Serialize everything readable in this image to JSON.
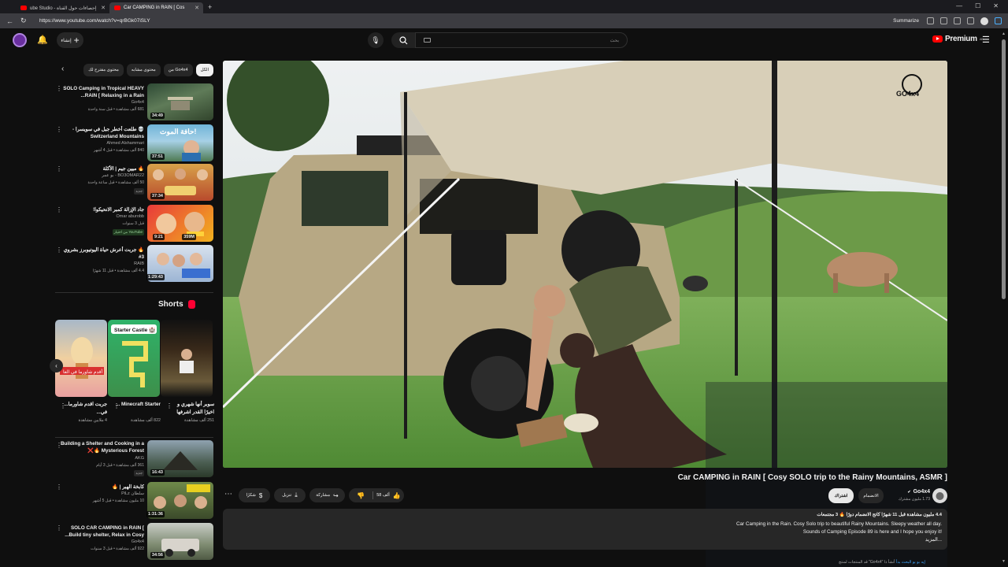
{
  "browser": {
    "tabs": [
      {
        "label": "ube Studio - إحصاءات حول القناة",
        "active": false
      },
      {
        "label": "Car CAMPING in RAIN [ Cos",
        "active": true
      }
    ],
    "url": "https://www.youtube.com/watch?v=qrBGk07iSLY",
    "summarize_label": "Summarize"
  },
  "header": {
    "create_label": "إنشاء",
    "search_placeholder": "بحث",
    "logo_text": "Premium",
    "logo_sup": "AE"
  },
  "chips": [
    "الكل",
    "من Go4x4",
    "محتوى مشابه",
    "محتوى مقترح لك"
  ],
  "recommendations": [
    {
      "title": "SOLO Camping in Tropical HEAVY RAIN [ Relaxing in a Rain...",
      "channel": "Go4x4",
      "meta": "681 ألف مشاهدة • قبل سنة واحدة",
      "duration": "34:49",
      "badge": ""
    },
    {
      "title": "💀 طلعت أخطر جبل في سويسرا - Switzerland Mountains",
      "channel": "Ahmed Alshammari",
      "meta": "840 ألف مشاهدة • قبل 4 أشهر",
      "duration": "37:51",
      "badge": ""
    },
    {
      "title": "🔥 ميين جيم | الأكلة",
      "channel": "BO3OMAR22 - بو عمر",
      "meta": "50 ألف مشاهدة • قبل ساعة واحدة",
      "duration": "37:34",
      "badge": "جديد"
    },
    {
      "title": "جاد الإزالة كمبر الانحيكوا!",
      "channel": "Omar aburobb",
      "meta": "قبل 3 سنوات",
      "duration": "9:21",
      "badge": "من اختيار YouTube"
    },
    {
      "title": "🔥 جربت أعرش حياة اليوتيوبرز بشروي 3#",
      "channel": "RAIB",
      "meta": "4.4 ألف مشاهدة • قبل 11 شهرًا",
      "duration": "1:29:43",
      "badge": ""
    }
  ],
  "shorts": {
    "heading": "Shorts",
    "items": [
      {
        "title": "سوبر أنها شهري و اخيرًا القدر اشرفها",
        "views": "251 ألف مشاهدة"
      },
      {
        "title": "Minecraft Starter ...",
        "views": "822 ألف مشاهدة"
      },
      {
        "title": "جربت اقدم شاورما... في...",
        "views": "4 ملايين مشاهدة"
      }
    ],
    "thumb_text_2": "Starter Castle 🏰",
    "thumb_text_3": "أقدم شاورما في العا"
  },
  "more_recs": [
    {
      "title": "Building a Shelter and Cooking in a Mysterious Forest 🔥❌",
      "channel": "AKG",
      "meta": "361 ألف مشاهدة • قبل 3 أيام",
      "duration": "16:43",
      "badge": "جديد"
    },
    {
      "title": "كابخة الهبر | 🔥",
      "channel": "سلطان PiLz",
      "meta": "10 مليون مشاهدة • قبل 5 أشهر",
      "duration": "1:31:36",
      "badge": ""
    },
    {
      "title": "SOLO CAR CAMPING in RAIN [ Build tiny shelter, Relax in Cosy...",
      "channel": "Go4x4",
      "meta": "922 ألف مشاهدة • قبل 3 سنوات",
      "duration": "34:56",
      "badge": ""
    }
  ],
  "video": {
    "title": "Car CAMPING in RAIN [ Cosy SOLO trip to the Rainy Mountains, ASMR ]",
    "channel": "Go4x4",
    "subscribers": "1.73 مليون مشترك",
    "subscribe_label": "اشتراك",
    "join_label": "الانضمام",
    "like_count": "58 ألف",
    "share_label": "مشاركة",
    "download_label": "تنزيل",
    "thanks_label": "شكرًا",
    "watermark": "GO4x4"
  },
  "description": {
    "meta": "4.4 مليون مشاهدة قبل 11 شهرًا  كاتج الانضمام دورًا 🔥 3 مجتمعات",
    "line1": "Car Camping in the Rain. Cosy Solo trip to beautiful Rainy Mountains. Sleepy weather all day.",
    "line2": "Sounds of Camping Episode 89 is here and I hope you enjoy it!",
    "more": "...المزيد"
  },
  "footer_note": {
    "text": "أنشأ ذا \"Go4x4\" قد  المنتجات لمنتج",
    "link": "إيه بو بو  البحث بدأ"
  }
}
